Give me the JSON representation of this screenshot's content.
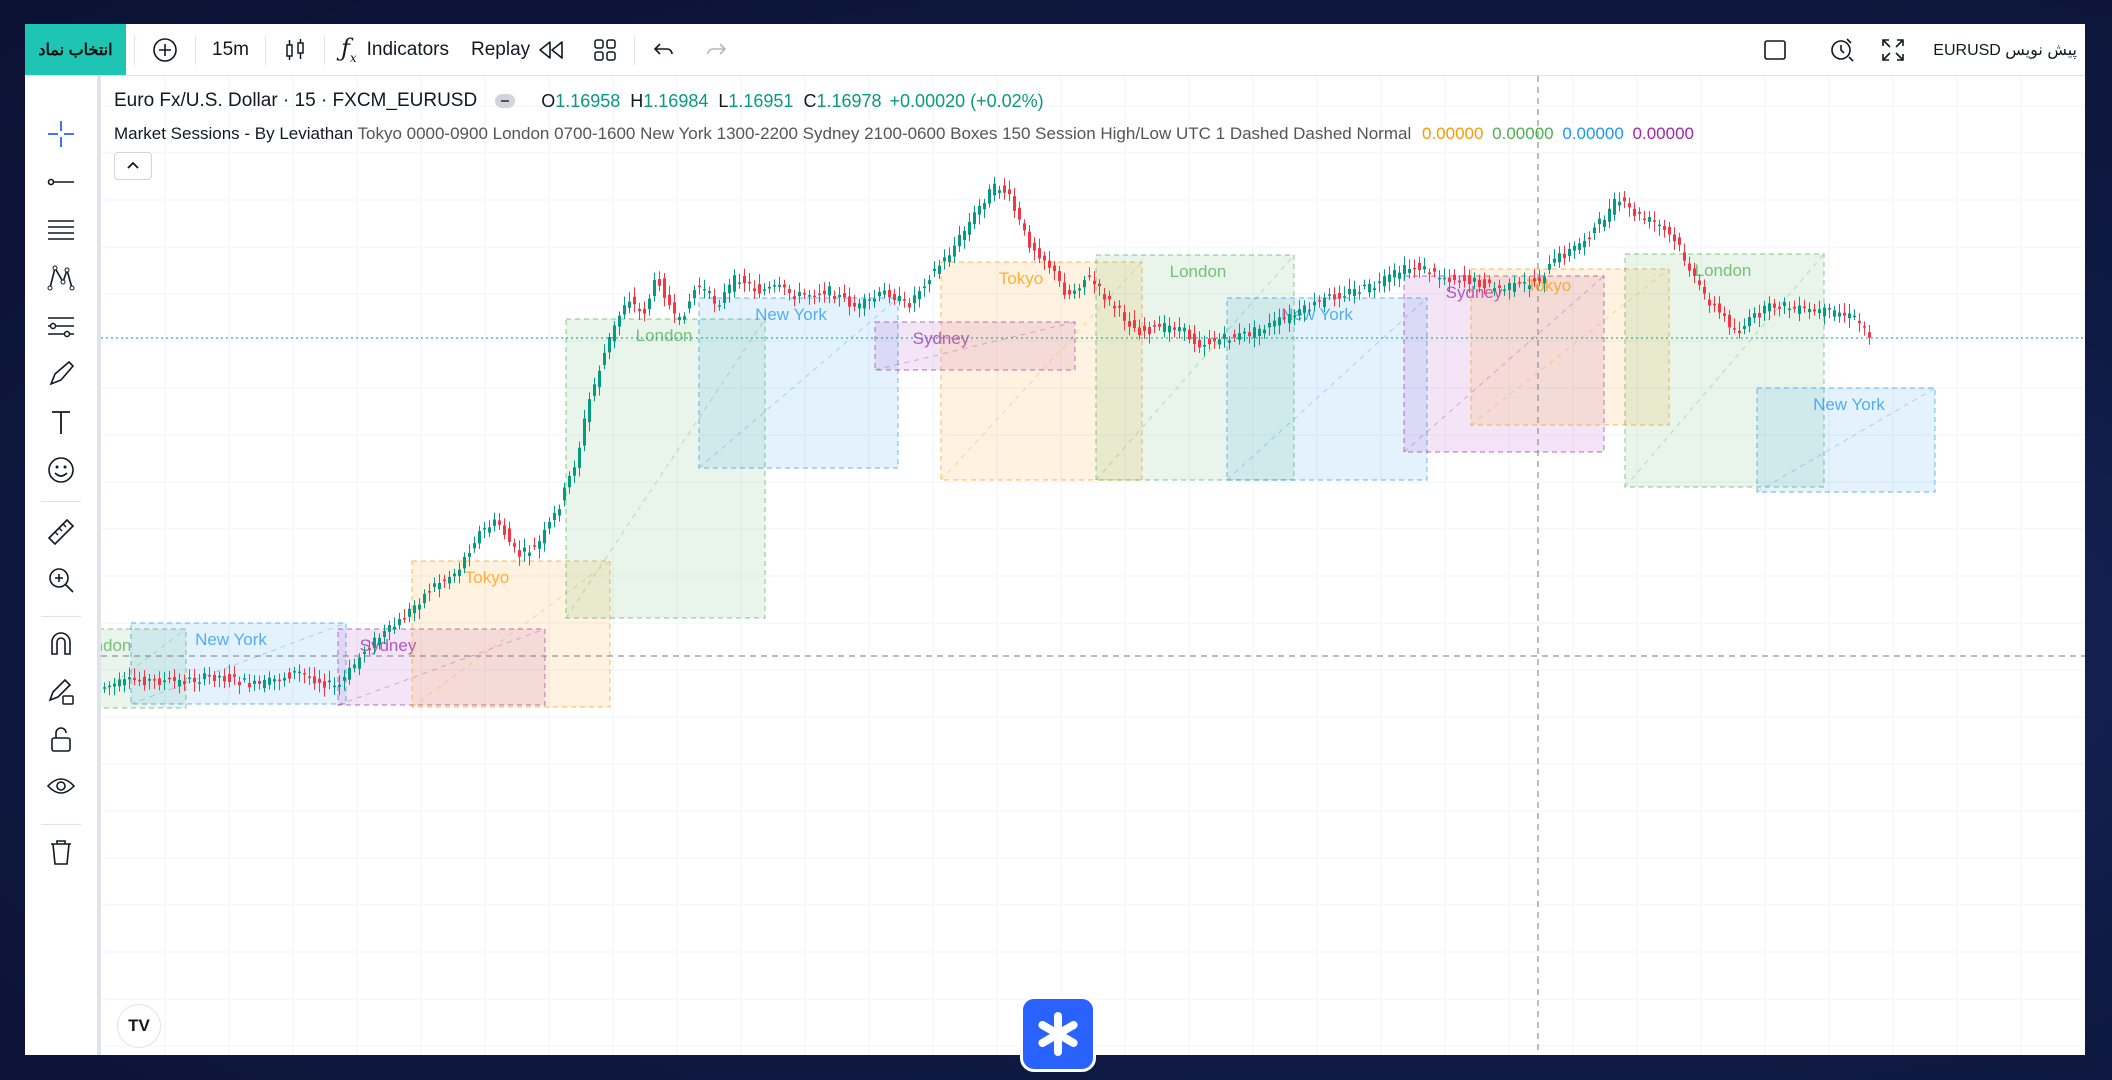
{
  "toolbar": {
    "symbol_button": "انتخاب نماد",
    "interval": "15m",
    "indicators_label": "Indicators",
    "replay_label": "Replay",
    "symbol_right": "EURUSD پیش نویس"
  },
  "legend": {
    "title": "Euro Fx/U.S. Dollar · 15 · FXCM_EURUSD",
    "o_label": "O",
    "o_value": "1.16958",
    "h_label": "H",
    "h_value": "1.16984",
    "l_label": "L",
    "l_value": "1.16951",
    "c_label": "C",
    "c_value": "1.16978",
    "change": "+0.00020 (+0.02%)",
    "indicator_name": "Market Sessions - By Leviathan",
    "indicator_params": "Tokyo 0000-0900 London 0700-1600 New York 1300-2200 Sydney 2100-0600 Boxes 150 Session High/Low UTC 1 Dashed Dashed Normal",
    "ind_v1": "0.00000",
    "ind_v2": "0.00000",
    "ind_v3": "0.00000",
    "ind_v4": "0.00000"
  },
  "colors": {
    "up": "#089981",
    "down": "#f23645",
    "london": "#4caf50",
    "new_york": "#2196f3",
    "tokyo": "#ff9800",
    "sydney": "#9c27b0",
    "toolbar_accent": "#1fc5b3"
  },
  "sessions": [
    {
      "name": "London"
    },
    {
      "name": "New York"
    },
    {
      "name": "Sydney"
    },
    {
      "name": "Tokyo"
    },
    {
      "name": "London"
    },
    {
      "name": "New York"
    },
    {
      "name": "Sydney"
    },
    {
      "name": "Tokyo"
    },
    {
      "name": "London"
    },
    {
      "name": "New York"
    },
    {
      "name": "Sydney"
    },
    {
      "name": "Tokyo"
    },
    {
      "name": "London"
    },
    {
      "name": "New York"
    }
  ],
  "left_tools": [
    "crosshair-icon",
    "trend-line-icon",
    "fib-lines-icon",
    "pattern-icon",
    "projection-icon",
    "brush-icon",
    "text-icon",
    "emoji-icon",
    "ruler-icon",
    "zoom-in-icon",
    "magnet-icon",
    "lock-drawing-icon",
    "unlock-icon",
    "eye-icon",
    "trash-icon"
  ],
  "logo_text": "TV"
}
